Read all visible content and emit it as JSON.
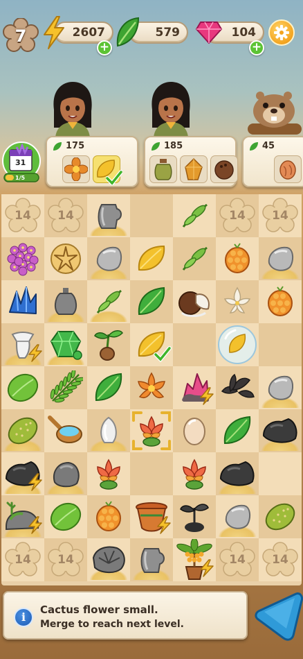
{
  "hud": {
    "level": "7",
    "energy": "2607",
    "leaves": "579",
    "gems": "104",
    "plus": "+"
  },
  "colors": {
    "energy": "#f6c12b",
    "leaf": "#3ea432",
    "gem": "#e8387e",
    "plus": "#5cc334",
    "info_blue": "#1c5bb5"
  },
  "event": {
    "day": "31",
    "progress": "1/5",
    "icon": "calendar-icon"
  },
  "orders": [
    {
      "reward": "175",
      "items": [
        "orange-flower",
        "yellow-leaf"
      ],
      "done": [
        false,
        true
      ]
    },
    {
      "reward": "185",
      "items": [
        "clay-jar",
        "amber-crystal",
        "coconut"
      ],
      "done": [
        false,
        false,
        false
      ]
    },
    {
      "reward": "45",
      "items": [
        "peach-fruit"
      ],
      "done": [
        false
      ]
    }
  ],
  "board": {
    "locked_label": "14",
    "rows": [
      [
        "locked",
        "locked",
        "pitcher",
        "empty",
        "green-sprig",
        "locked",
        "locked"
      ],
      [
        "purple-flower",
        "starfish-fossil",
        "grey-stone",
        "yellow-leaf",
        "green-sprig",
        "orange-flower",
        "grey-stone"
      ],
      [
        "blue-crystal",
        "clay-bottle",
        "green-sprig",
        "green-leaf",
        "coconut",
        "white-lily",
        "orange-flower"
      ],
      [
        "white-bandage",
        "emerald",
        "seedling",
        "yellow-leaf",
        "empty",
        "bubble",
        "empty"
      ],
      [
        "lime-leaf",
        "fern",
        "green-leaf",
        "succulent",
        "pink-crystal",
        "dark-seaweed",
        "grey-stone"
      ],
      [
        "cactus-pear",
        "water-scoop",
        "white-seed",
        "cactus-flower",
        "beige-egg",
        "green-leaf",
        "dark-rock"
      ],
      [
        "dark-rock",
        "grey-boulder",
        "cactus-flower",
        "empty",
        "cactus-flower",
        "dark-rock",
        "empty"
      ],
      [
        "mossy-rock",
        "lime-leaf",
        "orange-flower",
        "clay-pot",
        "dark-sprout",
        "grey-stone",
        "cactus-pear"
      ],
      [
        "locked",
        "locked",
        "grey-shell",
        "pitcher",
        "potted-palm",
        "locked",
        "locked"
      ]
    ]
  },
  "info": {
    "icon": "i",
    "title": "Cactus flower small.",
    "subtitle": "Merge to reach next level."
  }
}
